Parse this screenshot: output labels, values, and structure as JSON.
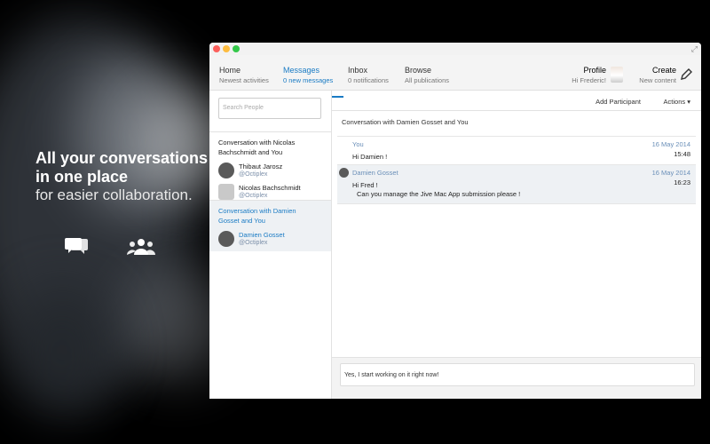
{
  "promo": {
    "line1": "All your conversations",
    "line2": "in one place",
    "line3": "for easier collaboration."
  },
  "nav": {
    "tabs": [
      {
        "label": "Home",
        "sub": "Newest activities"
      },
      {
        "label": "Messages",
        "sub": "0 new messages"
      },
      {
        "label": "Inbox",
        "sub": "0 notifications"
      },
      {
        "label": "Browse",
        "sub": "All publications"
      }
    ],
    "profile": {
      "label": "Profile",
      "sub": "Hi Frederic!"
    },
    "create": {
      "label": "Create",
      "sub": "New content"
    }
  },
  "sidebar": {
    "search_placeholder": "Search People",
    "conversations": [
      {
        "title_line1": "Conversation with Nicolas",
        "title_line2": "Bachschmidt and You",
        "participants": [
          {
            "name": "Thibaut Jarosz",
            "handle": "@Octiplex"
          },
          {
            "name": "Nicolas Bachschmidt",
            "handle": "@Octiplex"
          }
        ]
      },
      {
        "title_line1": "Conversation with Damien",
        "title_line2": "Gosset and You",
        "participants": [
          {
            "name": "Damien Gosset",
            "handle": "@Octiplex"
          }
        ]
      }
    ]
  },
  "main": {
    "add_participant": "Add Participant",
    "actions": "Actions ▾",
    "title": "Conversation with Damien Gosset and You",
    "messages": [
      {
        "author": "You",
        "date": "16 May 2014",
        "lines": [
          "Hi Damien !"
        ],
        "time": "15:48"
      },
      {
        "author": "Damien Gosset",
        "date": "16 May 2014",
        "lines": [
          "Hi Fred !",
          "Can you manage the Jive Mac App submission please !"
        ],
        "time": "16:23"
      }
    ],
    "composer_text": "Yes, I start working on it right now!"
  },
  "colors": {
    "accent": "#1a7bc4",
    "handle": "#7a8ea8",
    "meta": "#6a8fb8"
  }
}
